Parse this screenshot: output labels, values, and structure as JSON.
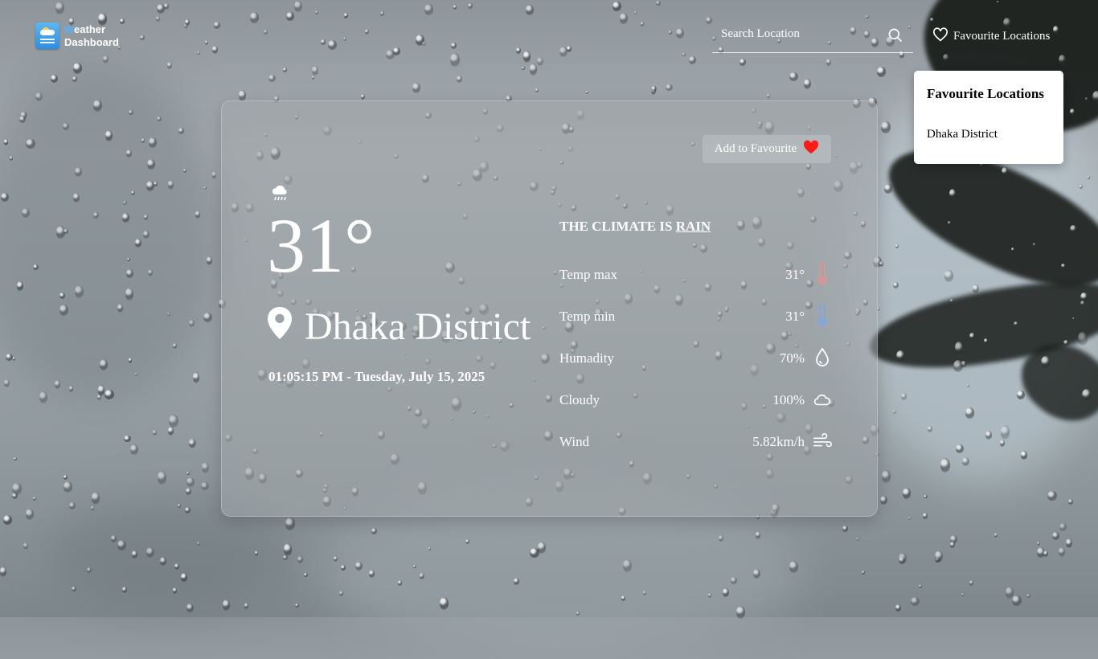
{
  "app": {
    "logo_first_letter": "W",
    "logo_line1_rest": "eather",
    "logo_line2": "Dashboard"
  },
  "search": {
    "placeholder": "Search Location",
    "value": ""
  },
  "nav": {
    "favourites_label": "Favourite Locations"
  },
  "favourites_dropdown": {
    "title": "Favourite Locations",
    "items": [
      "Dhaka District"
    ]
  },
  "weather": {
    "add_favourite_label": "Add to Favourite",
    "condition_icon": "cloud-rain-icon",
    "temperature": "31°",
    "location": "Dhaka District",
    "datetime": "01:05:15 PM - Tuesday, July 15, 2025",
    "climate_prefix": "The climate is",
    "climate_condition": "rain",
    "stats": [
      {
        "label": "Temp max",
        "value": "31°",
        "icon": "thermometer-hot-icon"
      },
      {
        "label": "Temp min",
        "value": "31°",
        "icon": "thermometer-cold-icon"
      },
      {
        "label": "Humadity",
        "value": "70%",
        "icon": "droplet-icon"
      },
      {
        "label": "Cloudy",
        "value": "100%",
        "icon": "cloud-icon"
      },
      {
        "label": "Wind",
        "value": "5.82km/h",
        "icon": "wind-icon"
      }
    ]
  },
  "colors": {
    "heart_red": "#ff1a1a",
    "thermometer_hot": "#e8908f",
    "thermometer_cold": "#7ea6e0",
    "logo_accent": "#4fb3ff"
  }
}
